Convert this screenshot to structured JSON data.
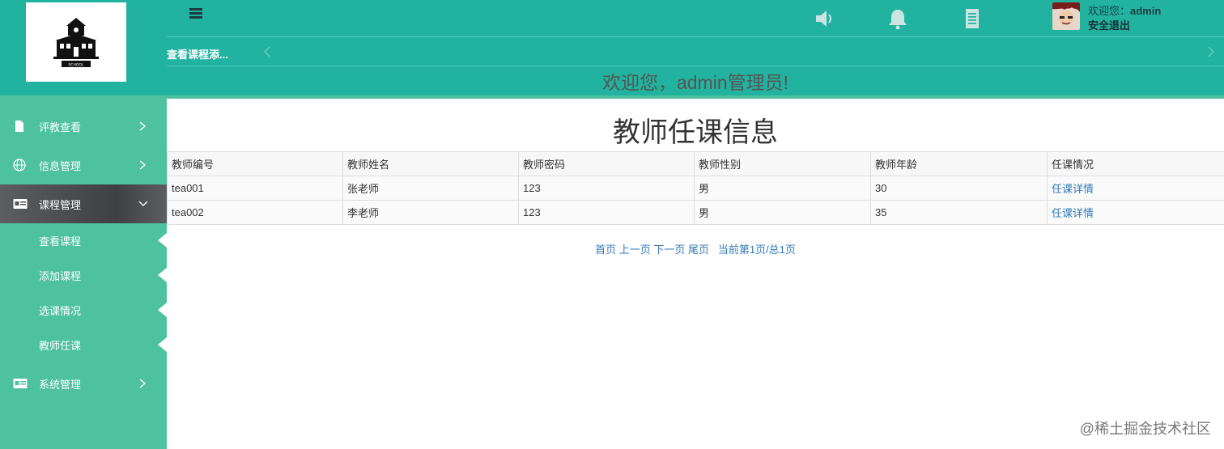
{
  "colors": {
    "header_bg": "#22b3a0",
    "sidebar_bg": "#4ec19f",
    "active_item_bg": "#4a4b4c",
    "link": "#337ab7"
  },
  "logo": {
    "caption": "SCHOOL"
  },
  "sidebar": {
    "items": [
      {
        "label": "评教查看",
        "icon": "file-icon",
        "expanded": false
      },
      {
        "label": "信息管理",
        "icon": "globe-icon",
        "expanded": false
      },
      {
        "label": "课程管理",
        "icon": "id-card-icon",
        "expanded": true,
        "children": [
          {
            "label": "查看课程"
          },
          {
            "label": "添加课程"
          },
          {
            "label": "选课情况"
          },
          {
            "label": "教师任课"
          }
        ]
      },
      {
        "label": "系统管理",
        "icon": "id-card-icon",
        "expanded": false
      }
    ]
  },
  "header": {
    "tab_label": "查看课程添...",
    "welcome_prefix": "欢迎您：",
    "username": "admin",
    "logout_label": "安全退出",
    "banner": "欢迎您，admin管理员!",
    "icons": [
      "volume-icon",
      "bell-icon",
      "document-icon"
    ]
  },
  "main": {
    "title": "教师任课信息",
    "table": {
      "columns": [
        "教师编号",
        "教师姓名",
        "教师密码",
        "教师性别",
        "教师年龄",
        "任课情况"
      ],
      "rows": [
        [
          "tea001",
          "张老师",
          "123",
          "男",
          "30",
          "任课详情"
        ],
        [
          "tea002",
          "李老师",
          "123",
          "男",
          "35",
          "任课详情"
        ]
      ]
    },
    "pager": {
      "first": "首页",
      "prev": "上一页",
      "next": "下一页",
      "last": "尾页",
      "status": "当前第1页/总1页"
    }
  },
  "watermark": "@稀土掘金技术社区"
}
